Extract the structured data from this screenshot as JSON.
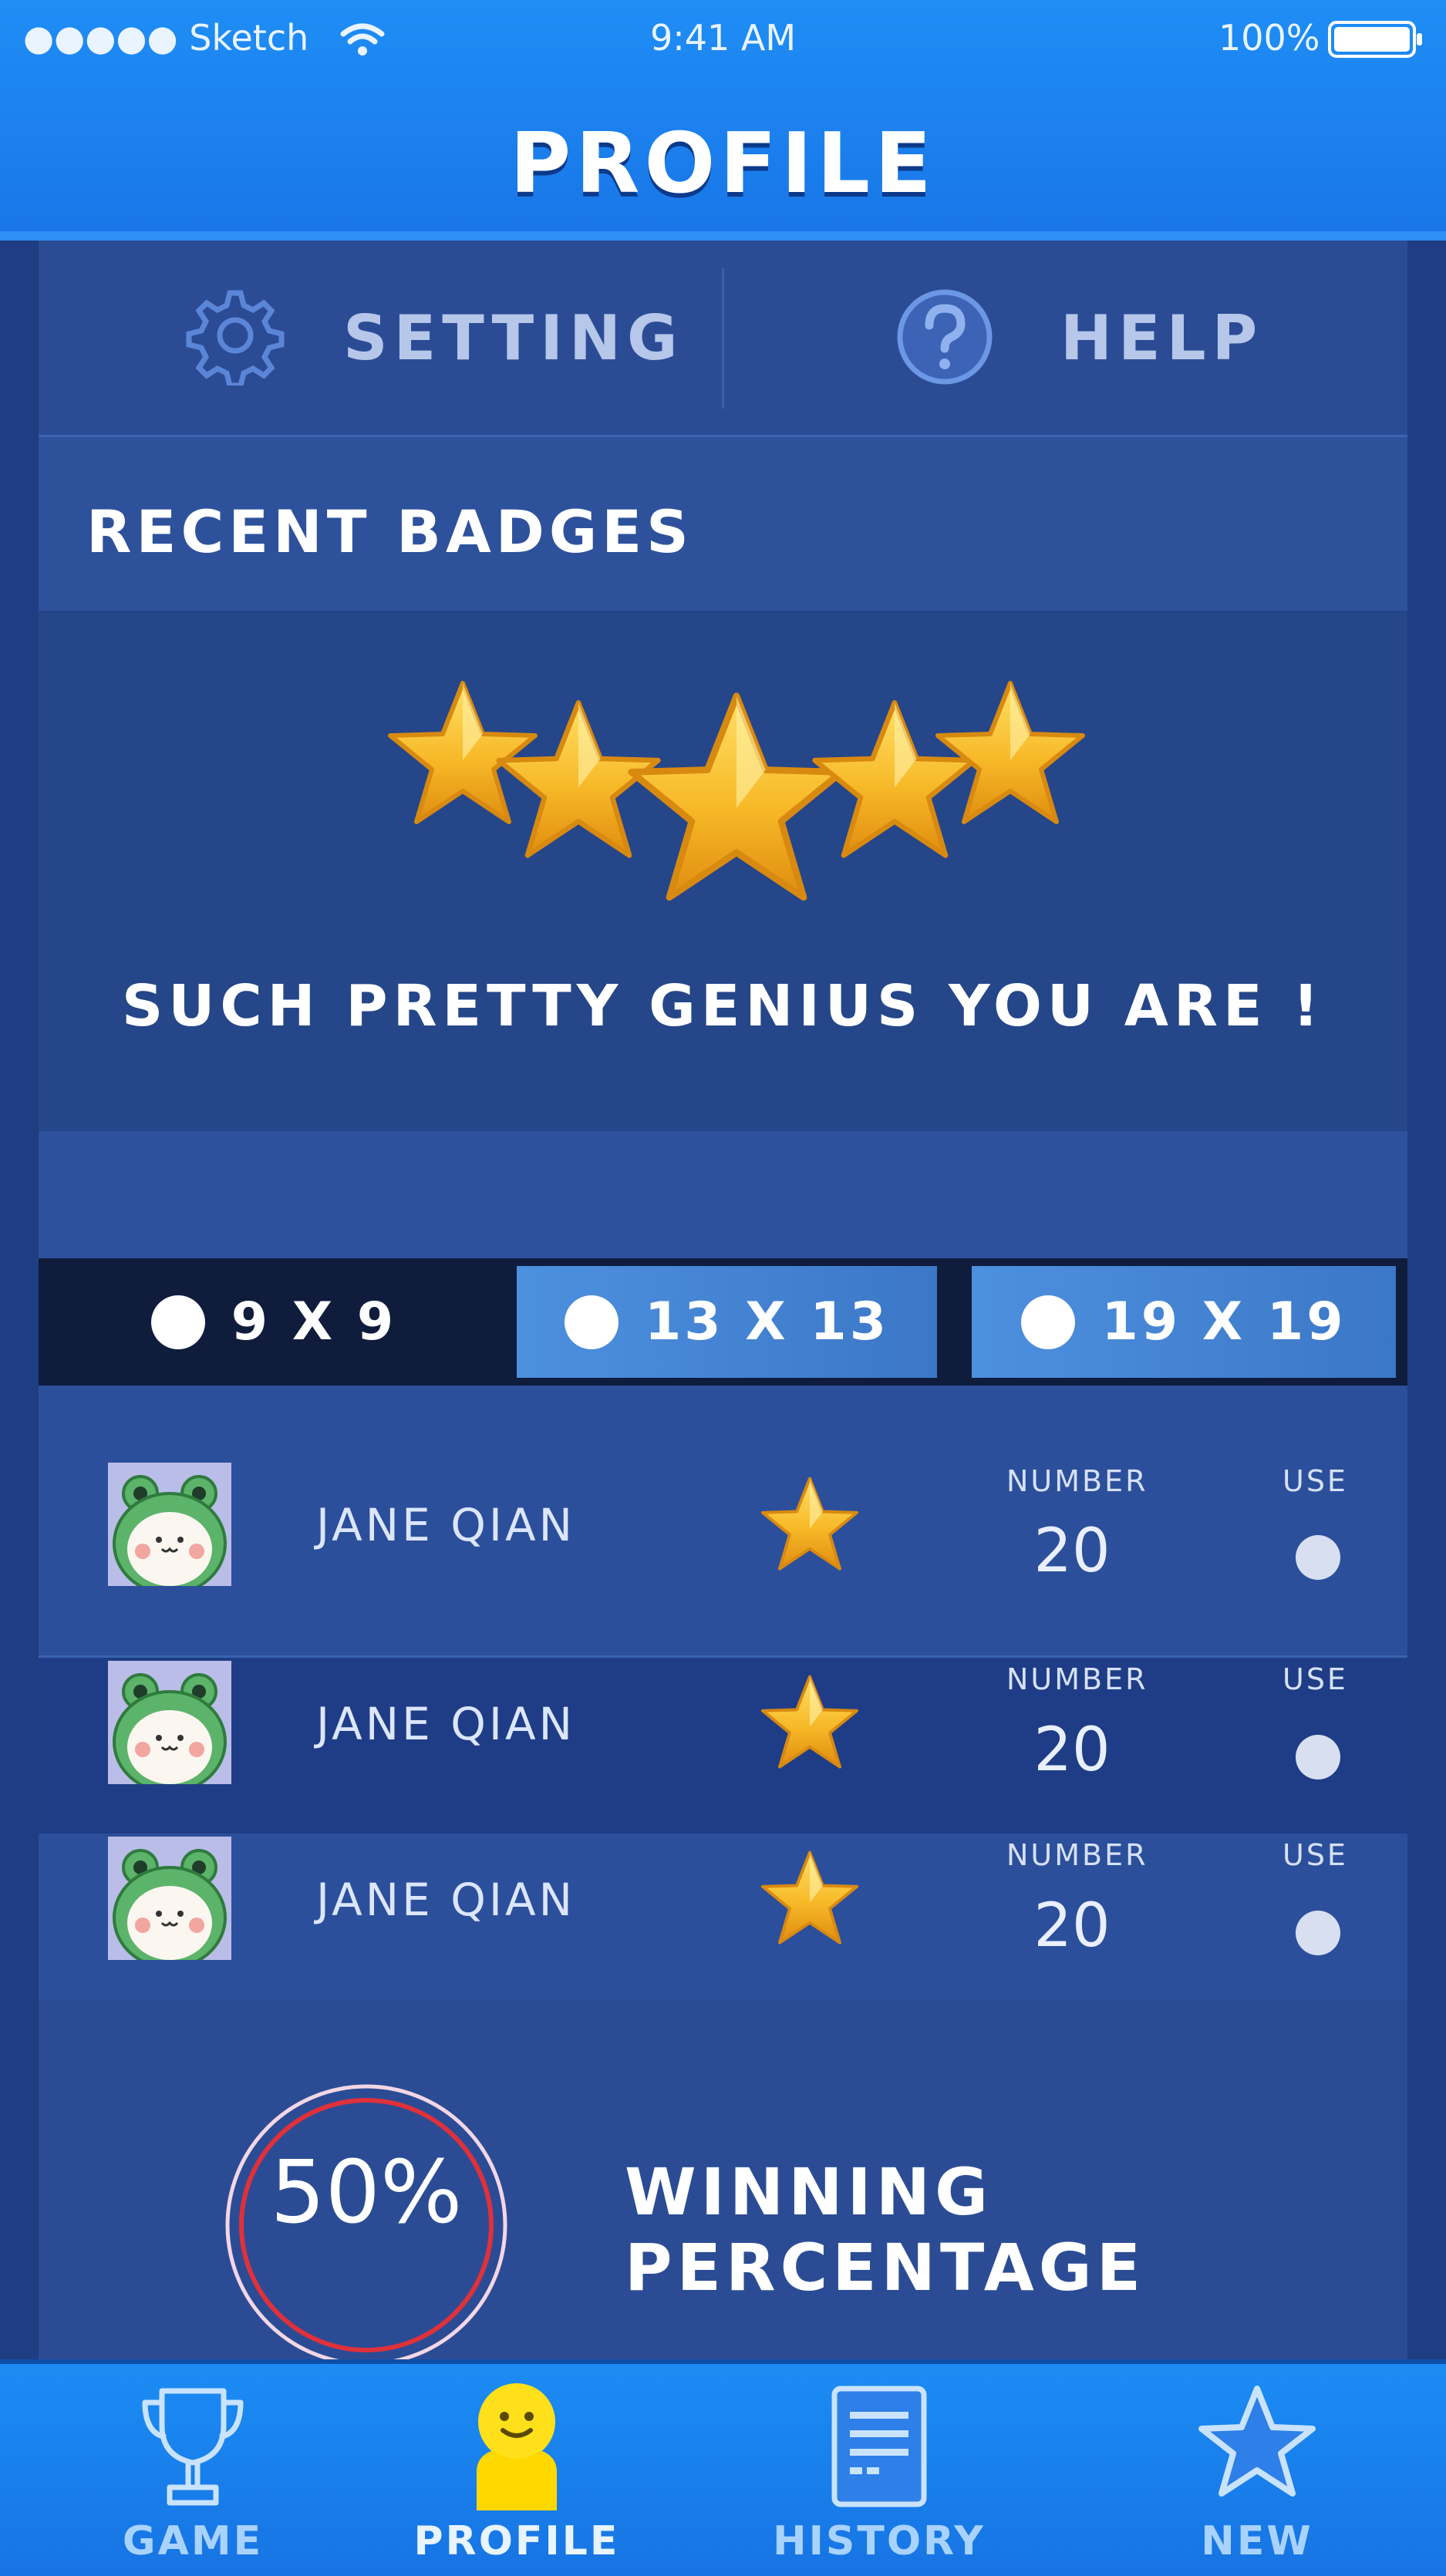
{
  "status_bar": {
    "carrier": "●●●●● Sketch",
    "time": "9:41 AM",
    "battery": "100%"
  },
  "header": {
    "title": "PROFILE"
  },
  "quick_actions": {
    "setting": "SETTING",
    "help": "HELP"
  },
  "badges": {
    "section_title": "RECENT BADGES",
    "stars_shown": 5,
    "caption": "SUCH PRETTY GENIUS YOU ARE !"
  },
  "board_sizes": {
    "selected": "9 X 9",
    "options": [
      {
        "label": "9 X 9",
        "selected": true
      },
      {
        "label": "13 X 13",
        "selected": false
      },
      {
        "label": "19 X 19",
        "selected": false
      }
    ]
  },
  "players": {
    "columns": {
      "number": "NUMBER",
      "use": "USE"
    },
    "rows": [
      {
        "name": "JANE QIAN",
        "number": "20"
      },
      {
        "name": "JANE QIAN",
        "number": "20"
      },
      {
        "name": "JANE QIAN",
        "number": "20"
      }
    ]
  },
  "stats": {
    "winning_value": "50%",
    "winning_fraction": 0.5,
    "winning_label": "WINNING PERCENTAGE"
  },
  "tab_bar": {
    "active": "PROFILE",
    "items": [
      {
        "label": "GAME",
        "icon": "trophy-icon"
      },
      {
        "label": "PROFILE",
        "icon": "smiley-avatar-icon"
      },
      {
        "label": "HISTORY",
        "icon": "document-icon"
      },
      {
        "label": "NEW",
        "icon": "star-outline-icon"
      }
    ]
  },
  "colors": {
    "top_bar": "#1f8ef5",
    "panel": "#2b4c95",
    "selected_tab": "#0f1c3c",
    "unselected_tab": "#4d90df",
    "gold": "#f7b928",
    "ring": "#e0313a"
  }
}
